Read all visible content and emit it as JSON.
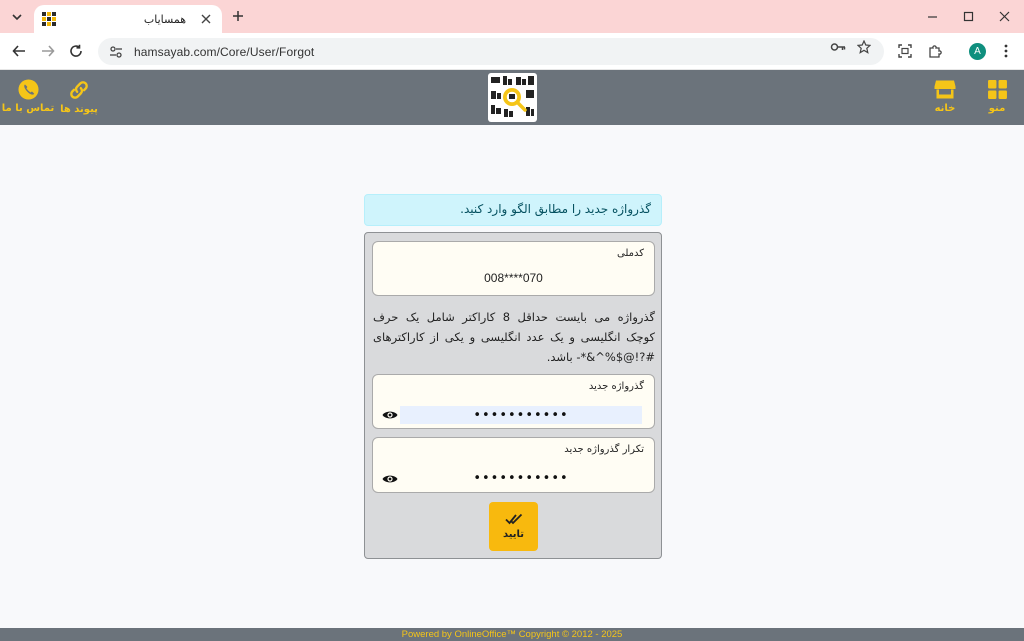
{
  "browser": {
    "tab_title": "همسایاب",
    "url": "hamsayab.com/Core/User/Forgot",
    "profile_initial": "A"
  },
  "header": {
    "menu_label": "منو",
    "home_label": "خانه",
    "links_label": "پیوند ها",
    "contact_label": "تماس با ما"
  },
  "alert": {
    "text": "گذرواژه جدید را مطابق الگو وارد کنید."
  },
  "form": {
    "national_code_label": "کدملی",
    "national_code_value": "008****070",
    "rule_text": "گذرواژه می بایست حداقل 8 کاراکتر شامل یک حرف کوچک انگلیسی و یک عدد انگلیسی و یکی از کاراکترهای #?!@$%^&*- باشد.",
    "new_password_label": "گذرواژه جدید",
    "new_password_value": "•••••••••••",
    "repeat_password_label": "تکرار گذرواژه جدید",
    "repeat_password_value": "•••••••••••",
    "submit_label": "تایید"
  },
  "footer": {
    "text": "Powered by OnlineOffice™ Copyright © 2012 - 2025"
  },
  "colors": {
    "header_bg": "#6b737b",
    "accent_yellow": "#f5c518",
    "button_yellow": "#f8b90e",
    "alert_bg": "#cff4fc",
    "tabstrip_bg": "#fbd5d5"
  }
}
